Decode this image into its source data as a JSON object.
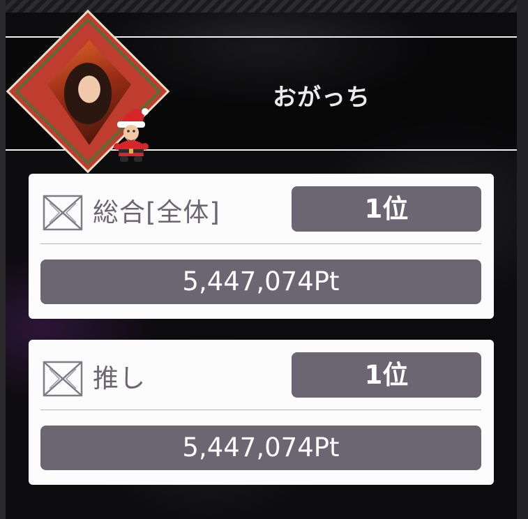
{
  "profile": {
    "username": "おがっち",
    "avatar_icon": "profile-photo-icon",
    "badge_icon": "santa-icon"
  },
  "rankings": [
    {
      "label": "総合[全体]",
      "rank": "1位",
      "points": "5,447,074Pt",
      "icon": "ribbon-icon"
    },
    {
      "label": "推し",
      "rank": "1位",
      "points": "5,447,074Pt",
      "icon": "ribbon-icon"
    }
  ],
  "colors": {
    "card_background": "#fdfcfd",
    "box_fill": "#6b6672",
    "label_text": "#6b6672",
    "frame_red": "#bf3d2f",
    "frame_green": "#3b7a3a"
  }
}
